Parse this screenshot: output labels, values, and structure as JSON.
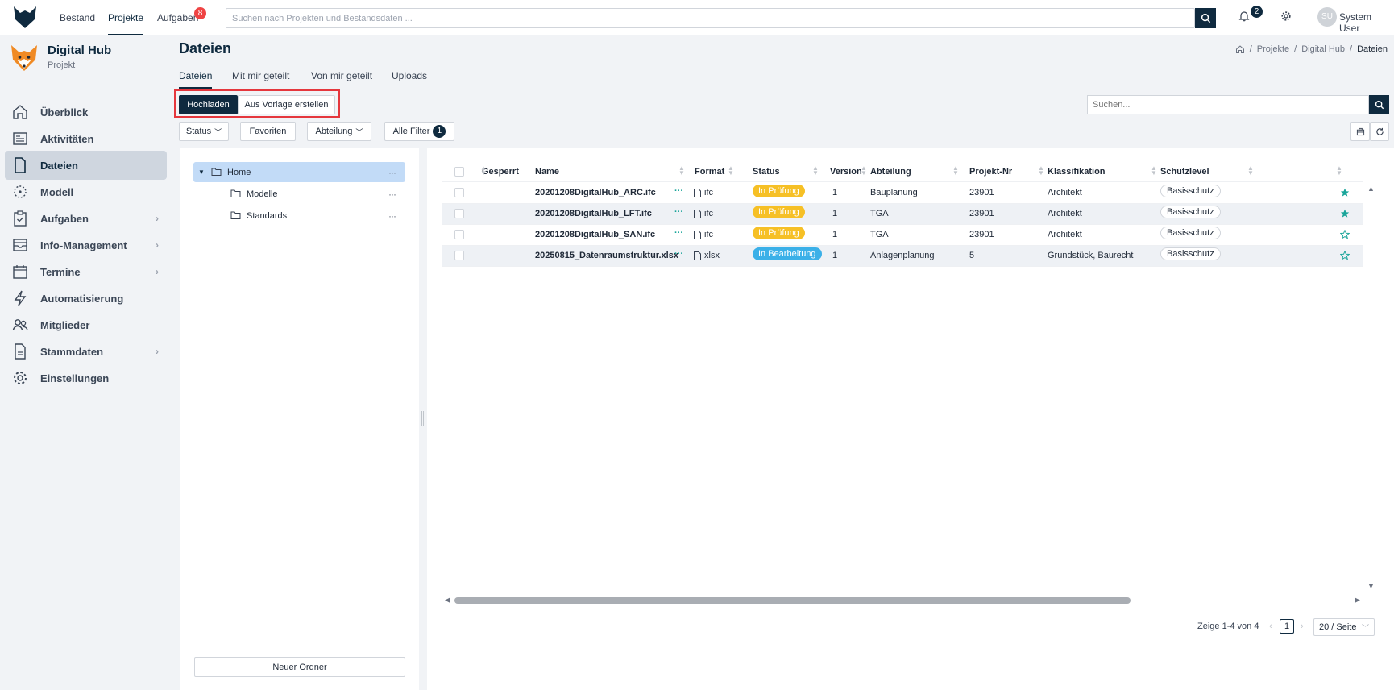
{
  "topbar": {
    "nav": [
      "Bestand",
      "Projekte",
      "Aufgaben"
    ],
    "tasks_badge": "8",
    "search_placeholder": "Suchen nach Projekten und Bestandsdaten ...",
    "notifications_badge": "2",
    "user_initials": "SU",
    "user_name": "System User"
  },
  "project": {
    "name": "Digital Hub",
    "type": "Projekt"
  },
  "sidebar": {
    "items": [
      {
        "label": "Überblick",
        "icon": "home-icon"
      },
      {
        "label": "Aktivitäten",
        "icon": "activity-icon"
      },
      {
        "label": "Dateien",
        "icon": "file-icon",
        "active": true
      },
      {
        "label": "Modell",
        "icon": "model-icon"
      },
      {
        "label": "Aufgaben",
        "icon": "clipboard-icon",
        "chevron": true
      },
      {
        "label": "Info-Management",
        "icon": "inbox-icon",
        "chevron": true
      },
      {
        "label": "Termine",
        "icon": "calendar-icon",
        "chevron": true
      },
      {
        "label": "Automatisierung",
        "icon": "lightning-icon"
      },
      {
        "label": "Mitglieder",
        "icon": "users-icon"
      },
      {
        "label": "Stammdaten",
        "icon": "document-icon",
        "chevron": true
      },
      {
        "label": "Einstellungen",
        "icon": "gear-icon"
      }
    ]
  },
  "page": {
    "title": "Dateien",
    "breadcrumb": [
      "Projekte",
      "Digital Hub",
      "Dateien"
    ],
    "tabs": [
      "Dateien",
      "Mit mir geteilt",
      "Von mir geteilt",
      "Uploads"
    ]
  },
  "actions": {
    "upload": "Hochladen",
    "template": "Aus Vorlage erstellen",
    "search_placeholder": "Suchen..."
  },
  "filters": {
    "status": "Status",
    "favorites": "Favoriten",
    "department": "Abteilung",
    "all": "Alle Filter",
    "all_count": "1"
  },
  "tree": {
    "items": [
      {
        "label": "Home",
        "selected": true,
        "level": 0
      },
      {
        "label": "Modelle",
        "level": 1
      },
      {
        "label": "Standards",
        "level": 1
      }
    ],
    "new_folder": "Neuer Ordner"
  },
  "table": {
    "columns": [
      "Gesperrt",
      "Name",
      "Format",
      "Status",
      "Version",
      "Abteilung",
      "Projekt-Nr",
      "Klassifikation",
      "Schutzlevel"
    ],
    "rows": [
      {
        "name": "20201208DigitalHub_ARC.ifc",
        "format": "ifc",
        "status": "In Prüfung",
        "status_color": "#f6c026",
        "version": "1",
        "department": "Bauplanung",
        "project_nr": "23901",
        "classification": "Architekt",
        "protection": "Basisschutz",
        "favorite": true
      },
      {
        "name": "20201208DigitalHub_LFT.ifc",
        "format": "ifc",
        "status": "In Prüfung",
        "status_color": "#f6c026",
        "version": "1",
        "department": "TGA",
        "project_nr": "23901",
        "classification": "Architekt",
        "protection": "Basisschutz",
        "favorite": true
      },
      {
        "name": "20201208DigitalHub_SAN.ifc",
        "format": "ifc",
        "status": "In Prüfung",
        "status_color": "#f6c026",
        "version": "1",
        "department": "TGA",
        "project_nr": "23901",
        "classification": "Architekt",
        "protection": "Basisschutz",
        "favorite": false
      },
      {
        "name": "20250815_Datenraumstruktur.xlsx",
        "format": "xlsx",
        "status": "In Bearbeitung",
        "status_color": "#3bb0e8",
        "version": "1",
        "department": "Anlagenplanung",
        "project_nr": "5",
        "classification": "Grundstück, Baurecht",
        "protection": "Basisschutz",
        "favorite": false
      }
    ]
  },
  "pagination": {
    "summary": "Zeige 1-4 von 4",
    "page": "1",
    "per_page": "20 / Seite"
  },
  "colors": {
    "primary": "#0f2a3f",
    "accent_star": "#1aa59a",
    "highlight": "#e5373d"
  }
}
